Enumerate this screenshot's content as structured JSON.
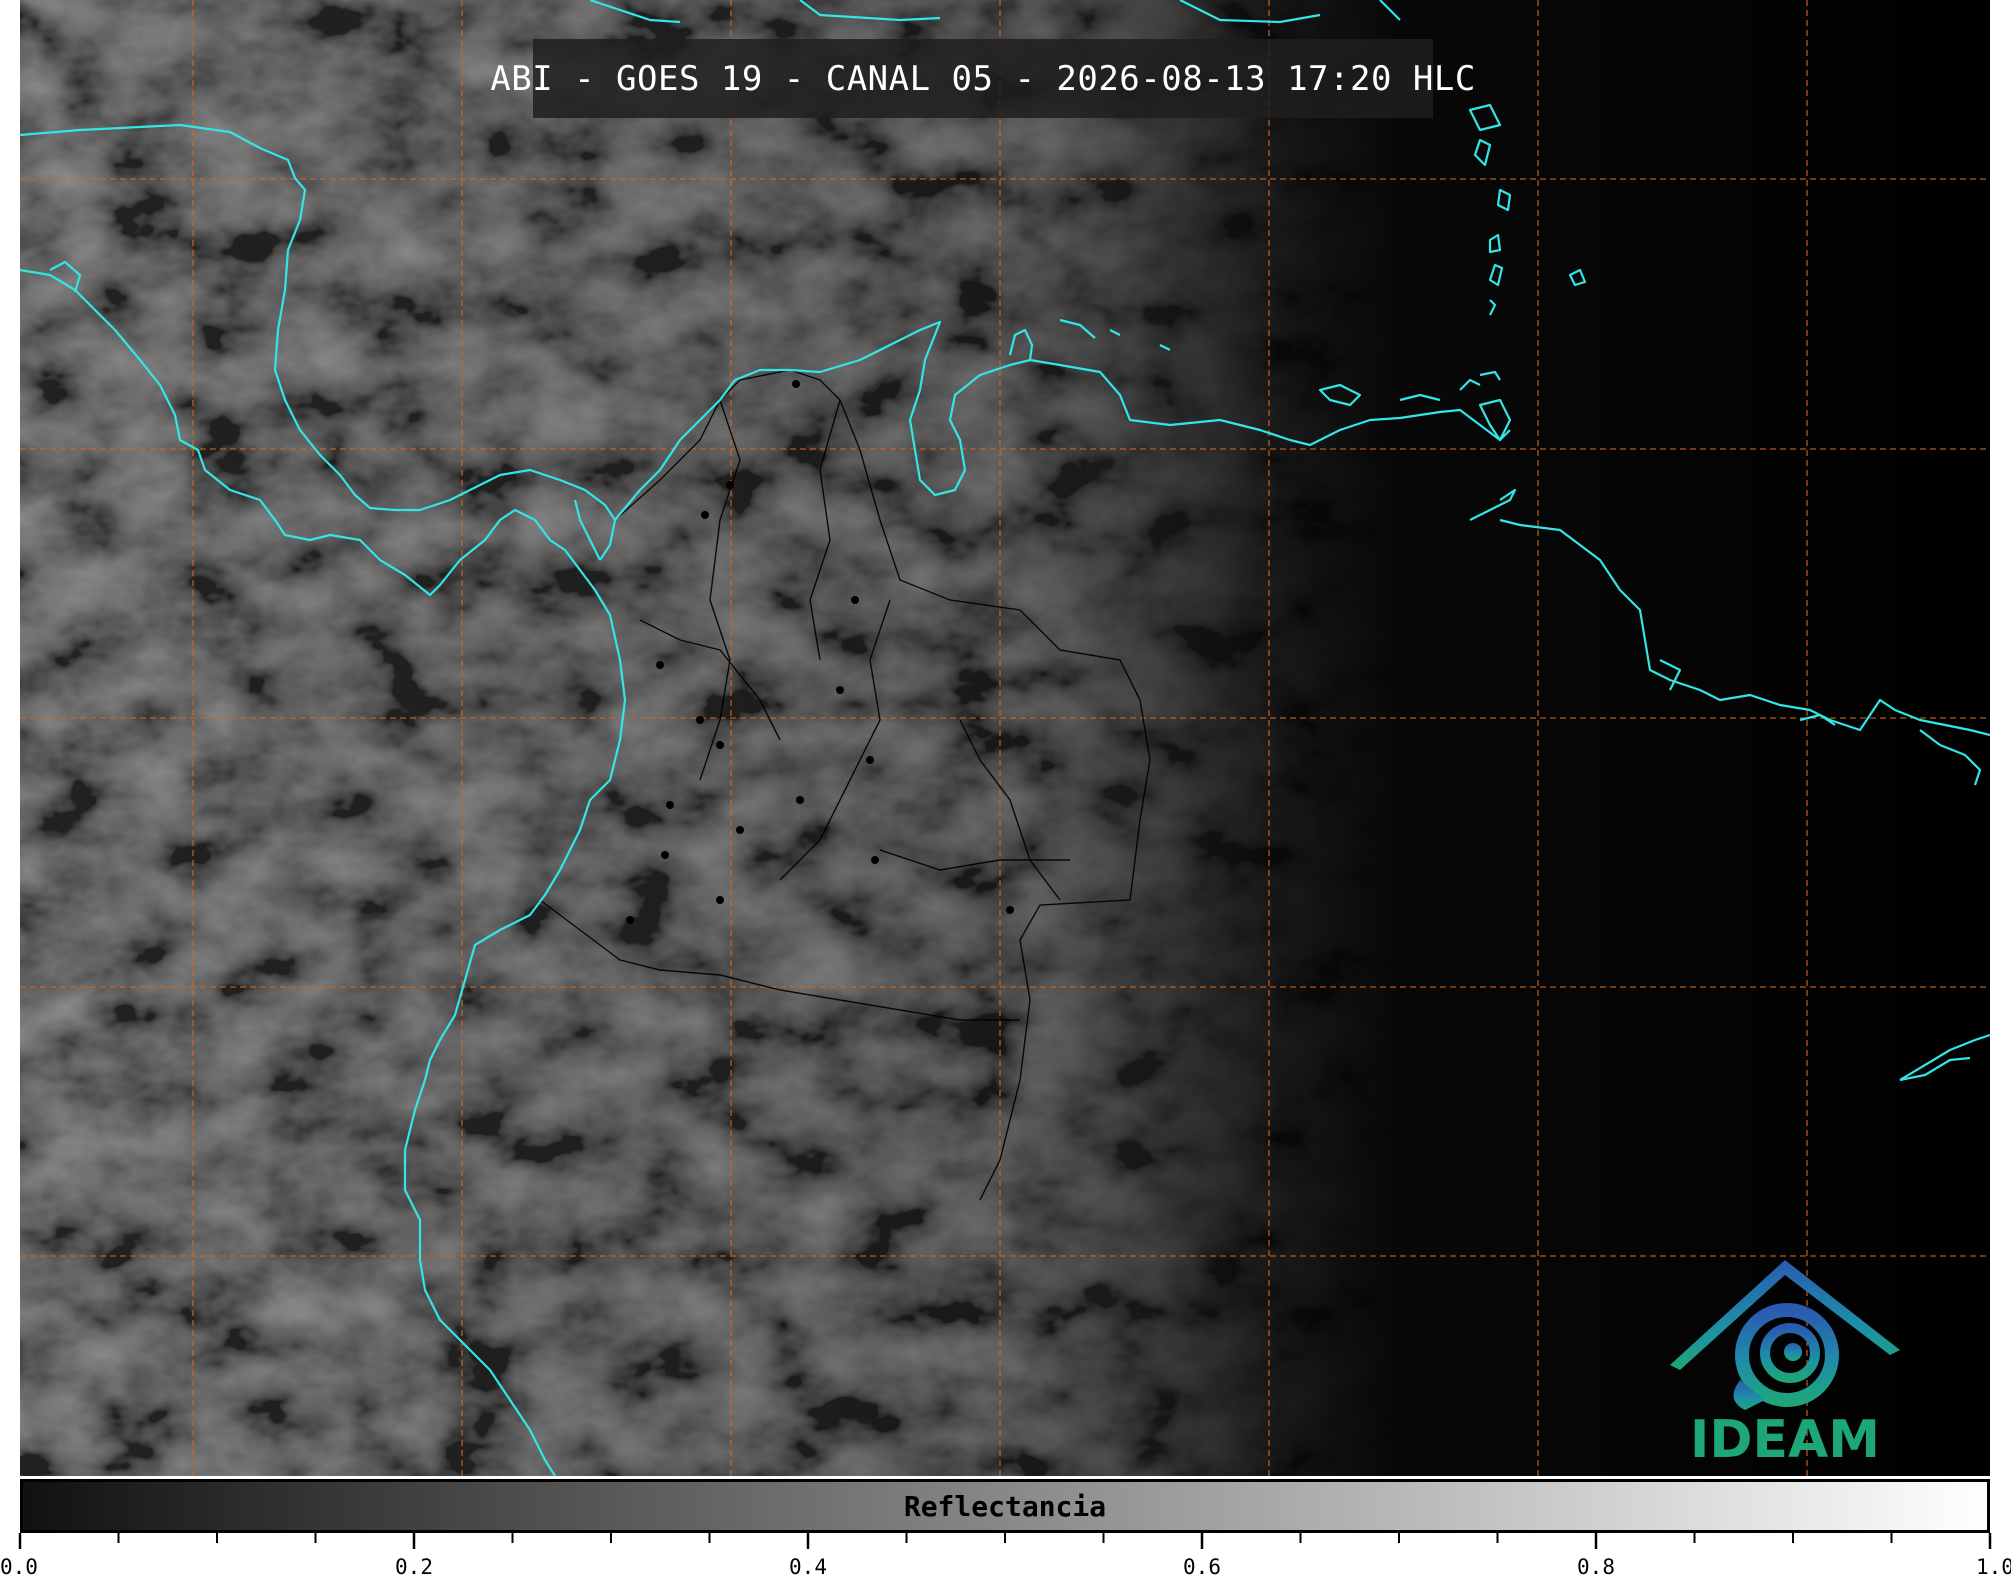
{
  "title": "ABI - GOES 19 - CANAL 05 - 2026-08-13 17:20 HLC",
  "logo": {
    "text": "IDEAM",
    "icon": "ideam-logo-icon"
  },
  "colorbar": {
    "label": "Reflectancia",
    "min": 0.0,
    "max": 1.0,
    "tick_labels": [
      "0.0",
      "0.2",
      "0.4",
      "0.6",
      "0.8",
      "1.0"
    ],
    "colors": {
      "start": "#111111",
      "end": "#ffffff"
    }
  },
  "colors": {
    "coastline": "#33e6e6",
    "grid": "#d2691e",
    "borders": "#000000",
    "background": "#000000",
    "title_box": "#1e1e1e"
  }
}
